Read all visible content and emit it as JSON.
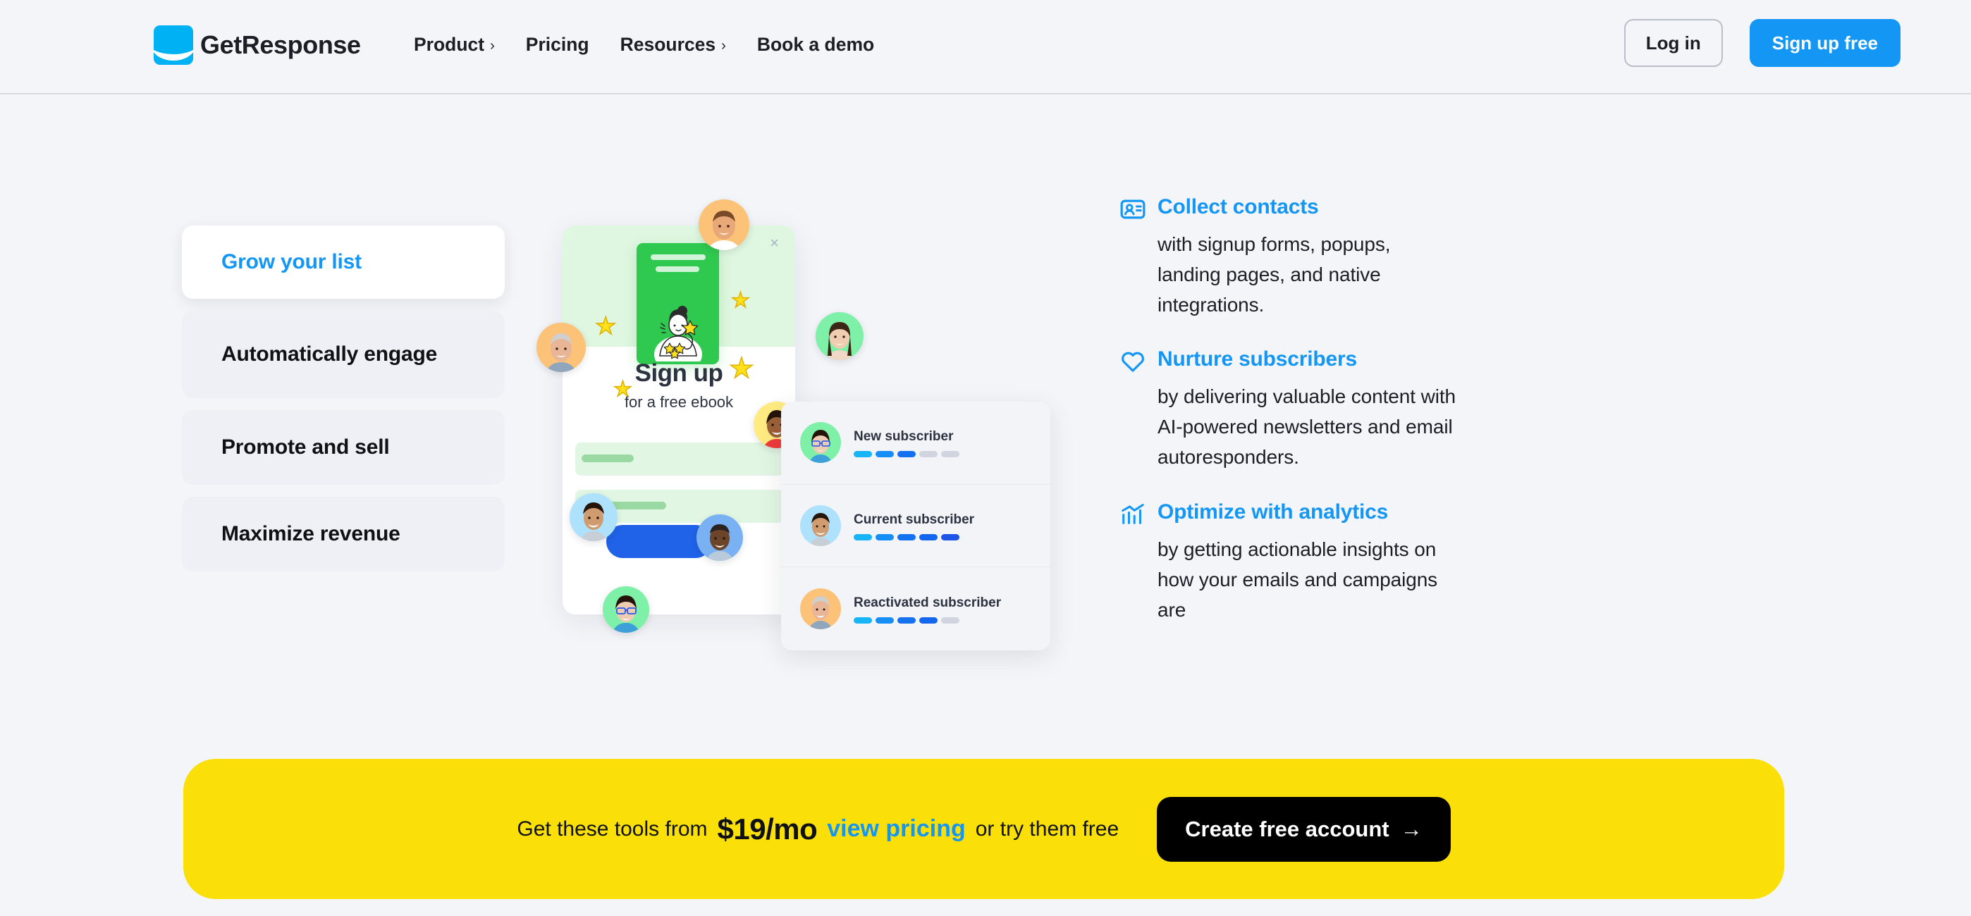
{
  "header": {
    "logo_text": "GetResponse",
    "nav": [
      {
        "label": "Product",
        "caret": "›"
      },
      {
        "label": "Pricing",
        "caret": ""
      },
      {
        "label": "Resources",
        "caret": "›"
      },
      {
        "label": "Book a demo",
        "caret": ""
      }
    ],
    "login_label": "Log in",
    "signup_label": "Sign up free"
  },
  "tabs": [
    {
      "label": "Grow your list",
      "active": true
    },
    {
      "label": "Automatically engage",
      "active": false
    },
    {
      "label": "Promote and sell",
      "active": false
    },
    {
      "label": "Maximize revenue",
      "active": false
    }
  ],
  "illustration": {
    "signup_title": "Sign up",
    "signup_subtitle": "for a free ebook",
    "close_icon": "×",
    "subscribers": [
      {
        "name": "New subscriber",
        "bars": [
          "#18b4f8",
          "#168ef5",
          "#1472f0",
          "#cfd4de",
          "#cfd4de"
        ]
      },
      {
        "name": "Current subscriber",
        "bars": [
          "#18b4f8",
          "#168ef5",
          "#1472f0",
          "#1466ee",
          "#1c55e8"
        ]
      },
      {
        "name": "Reactivated subscriber",
        "bars": [
          "#18b4f8",
          "#168ef5",
          "#1472f0",
          "#1466ee",
          "#cfd4de"
        ]
      }
    ]
  },
  "features": [
    {
      "icon": "contact-card-icon",
      "title": "Collect contacts",
      "desc": "with signup forms, popups, landing pages, and native integrations."
    },
    {
      "icon": "heart-icon",
      "title": "Nurture subscribers",
      "desc": "by delivering valuable content with AI-powered newsletters and email autoresponders."
    },
    {
      "icon": "analytics-chart-icon",
      "title": "Optimize with analytics",
      "desc": "by getting actionable insights on how your emails and campaigns are"
    }
  ],
  "cta": {
    "prefix": "Get these tools from",
    "price": "$19/mo",
    "link": "view pricing",
    "suffix": "or try them free",
    "button_label": "Create free account",
    "button_arrow": "→"
  },
  "colors": {
    "accent_blue": "#1496f5",
    "cta_yellow": "#fae008",
    "page_bg": "#f3f5f9",
    "logo_cyan": "#00b2f3",
    "green": "#2fc94f"
  }
}
